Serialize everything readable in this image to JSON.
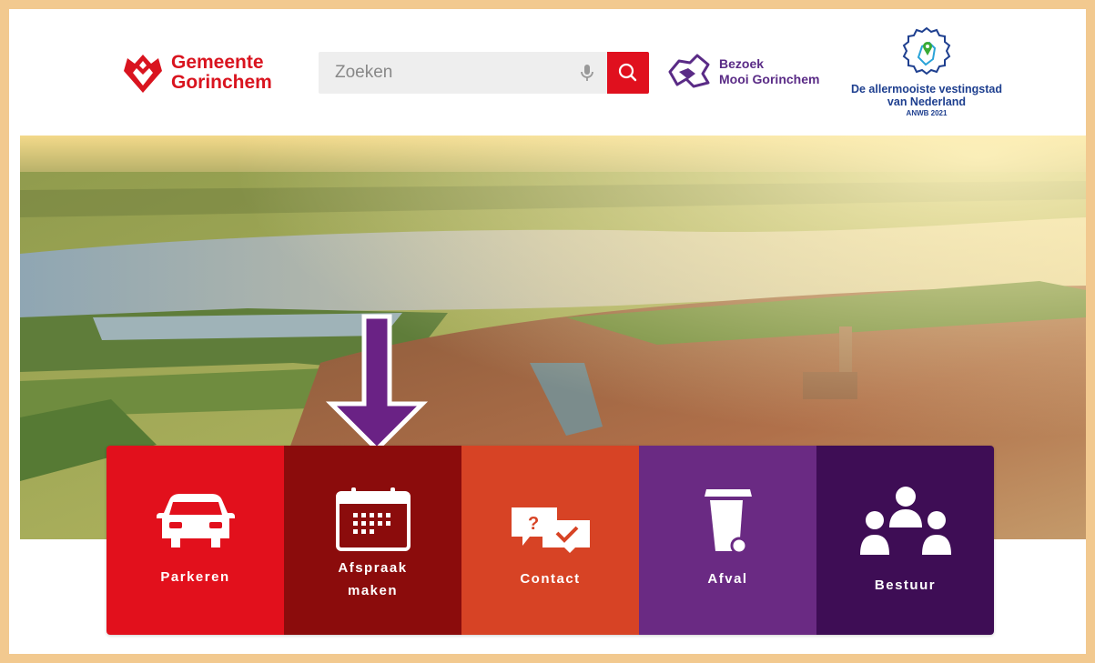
{
  "header": {
    "logo": {
      "line1": "Gemeente",
      "line2": "Gorinchem"
    },
    "search": {
      "placeholder": "Zoeken"
    },
    "visit": {
      "line1": "Bezoek",
      "line2": "Mooi Gorinchem"
    },
    "award": {
      "line1": "De allermooiste vestingstad",
      "line2": "van Nederland",
      "line3": "ANWB 2021"
    }
  },
  "tiles": [
    {
      "label": "Parkeren",
      "icon": "car-icon",
      "color": "#e2101c"
    },
    {
      "label": "Afspraak maken",
      "icon": "calendar-icon",
      "color": "#8b0c0c"
    },
    {
      "label": "Contact",
      "icon": "chat-bubbles-icon",
      "color": "#d74325"
    },
    {
      "label": "Afval",
      "icon": "waste-bin-icon",
      "color": "#6a2a83"
    },
    {
      "label": "Bestuur",
      "icon": "people-group-icon",
      "color": "#3e0d55"
    }
  ],
  "colors": {
    "brand_red": "#e0101e",
    "purple": "#5a2b86",
    "award_blue": "#1e3f8f",
    "arrow": "#6a2285",
    "frame": "#f2c98f"
  }
}
